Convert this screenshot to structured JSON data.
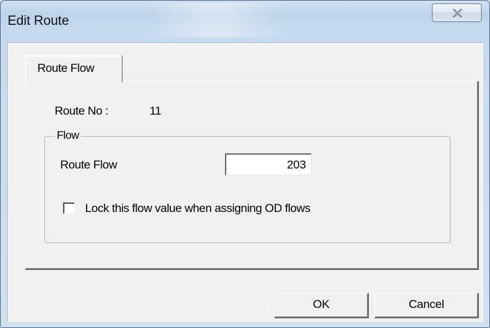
{
  "window": {
    "title": "Edit Route",
    "close_icon": "close-x-icon"
  },
  "tabs": [
    {
      "label": "Route Flow",
      "selected": true
    }
  ],
  "route": {
    "number_label": "Route No :",
    "number_value": "11"
  },
  "flow_group": {
    "title": "Flow",
    "route_flow_label": "Route Flow",
    "route_flow_value": "203",
    "lock_checkbox_label": "Lock this flow value when assigning OD flows",
    "lock_checked": false
  },
  "buttons": {
    "ok": "OK",
    "cancel": "Cancel"
  }
}
